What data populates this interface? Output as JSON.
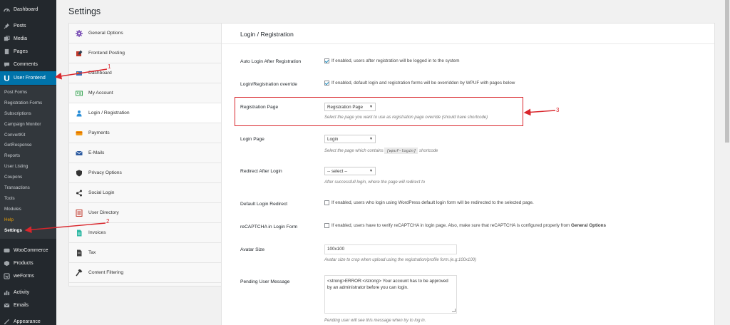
{
  "admin_menu": {
    "items": [
      {
        "label": "Dashboard",
        "icon": "dashboard-icon"
      },
      {
        "label": "Posts",
        "icon": "pin-icon"
      },
      {
        "label": "Media",
        "icon": "media-icon"
      },
      {
        "label": "Pages",
        "icon": "pages-icon"
      },
      {
        "label": "Comments",
        "icon": "comments-icon"
      },
      {
        "label": "User Frontend",
        "icon": "wpuf-icon"
      }
    ],
    "submenu": [
      "Post Forms",
      "Registration Forms",
      "Subscriptions",
      "Campaign Monitor",
      "ConvertKit",
      "GetResponse",
      "Reports",
      "User Listing",
      "Coupons",
      "Transactions",
      "Tools",
      "Modules",
      "Help",
      "Settings"
    ],
    "lower_items": [
      {
        "label": "WooCommerce",
        "icon": "woocommerce-icon"
      },
      {
        "label": "Products",
        "icon": "products-icon"
      },
      {
        "label": "weForms",
        "icon": "weforms-icon"
      },
      {
        "label": "Activity",
        "icon": "activity-icon"
      },
      {
        "label": "Emails",
        "icon": "email-icon"
      },
      {
        "label": "Appearance",
        "icon": "appearance-icon"
      }
    ]
  },
  "page": {
    "title": "Settings"
  },
  "tabs": [
    {
      "label": "General Options",
      "icon": "gear-icon"
    },
    {
      "label": "Frontend Posting",
      "icon": "edit-icon"
    },
    {
      "label": "Dashboard",
      "icon": "dashboard-icon"
    },
    {
      "label": "My Account",
      "icon": "account-icon"
    },
    {
      "label": "Login / Registration",
      "icon": "user-icon"
    },
    {
      "label": "Payments",
      "icon": "payments-icon"
    },
    {
      "label": "E-Mails",
      "icon": "email-icon"
    },
    {
      "label": "Privacy Options",
      "icon": "shield-icon"
    },
    {
      "label": "Social Login",
      "icon": "share-icon"
    },
    {
      "label": "User Directory",
      "icon": "directory-icon"
    },
    {
      "label": "Invoices",
      "icon": "invoice-icon"
    },
    {
      "label": "Tax",
      "icon": "tax-icon"
    },
    {
      "label": "Content Filtering",
      "icon": "hammer-icon"
    }
  ],
  "panel": {
    "title": "Login / Registration",
    "auto_login": {
      "label": "Auto Login After Registration",
      "text": "If enabled, users after registration will be logged in to the system",
      "checked": true
    },
    "override": {
      "label": "Login/Registration override",
      "text": "If enabled, default login and registration forms will be overridden by WPUF with pages below",
      "checked": true
    },
    "registration_page": {
      "label": "Registration Page",
      "value": "Registration Page",
      "desc": "Select the page you want to use as registration page override (should have shortcode)"
    },
    "login_page": {
      "label": "Login Page",
      "value": "Login",
      "desc_prefix": "Select the page which contains",
      "desc_code": "[wpuf-login]",
      "desc_suffix": "shortcode"
    },
    "redirect": {
      "label": "Redirect After Login",
      "value": "-- select --",
      "desc": "After successfull login, where the page will redirect to"
    },
    "default_redirect": {
      "label": "Default Login Redirect",
      "text": "If enabled, users who login using WordPress default login form will be redirected to the selected page.",
      "checked": false
    },
    "recaptcha": {
      "label": "reCAPTCHA in Login Form",
      "text": "If enabled, users have to verify reCAPTCHA in login page. Also, make sure that reCAPTCHA is configured properly from",
      "text_bold": "General Options",
      "checked": false
    },
    "avatar": {
      "label": "Avatar Size",
      "value": "100x100",
      "desc": "Avatar size to crop when upload using the registration/profile form.(e.g:100x100)"
    },
    "pending": {
      "label": "Pending User Message",
      "value": "<strong>ERROR:</strong> Your account has to be approved by an administrator before you can login.",
      "desc": "Pending user will see this message when try to log in."
    }
  },
  "annotations": {
    "one": "1",
    "two": "2",
    "three": "3",
    "color": "#d9262c"
  },
  "colors": {
    "sidebar": "#23282d",
    "active": "#0073aa",
    "help": "#f0a202"
  }
}
